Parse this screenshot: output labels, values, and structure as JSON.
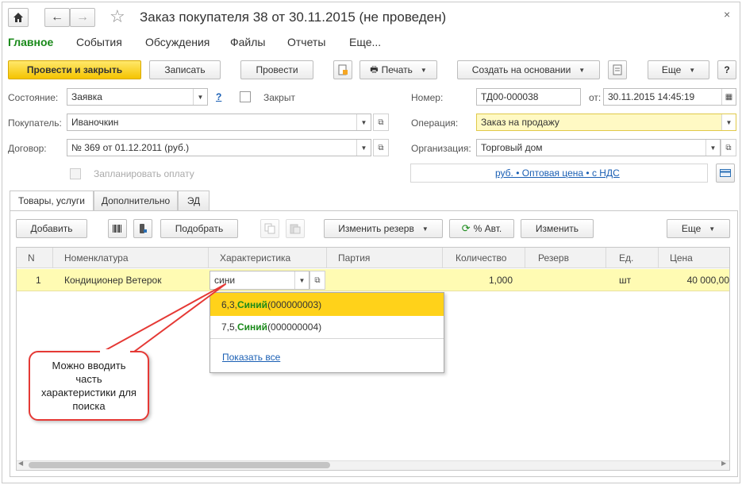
{
  "window": {
    "title": "Заказ покупателя 38 от 30.11.2015 (не проведен)"
  },
  "menu": [
    "Главное",
    "События",
    "Обсуждения",
    "Файлы",
    "Отчеты",
    "Еще..."
  ],
  "toolbar": {
    "post_close": "Провести и закрыть",
    "save": "Записать",
    "post": "Провести",
    "print": "Печать",
    "create_based": "Создать на основании",
    "more": "Еще",
    "help": "?"
  },
  "form": {
    "state_label": "Состояние:",
    "state_value": "Заявка",
    "state_help": "?",
    "closed_label": "Закрыт",
    "number_label": "Номер:",
    "number_value": "ТД00-000038",
    "date_label": "от:",
    "date_value": "30.11.2015 14:45:19",
    "buyer_label": "Покупатель:",
    "buyer_value": "Иваночкин",
    "operation_label": "Операция:",
    "operation_value": "Заказ на продажу",
    "contract_label": "Договор:",
    "contract_value": "№ 369 от 01.12.2011 (руб.)",
    "org_label": "Организация:",
    "org_value": "Торговый дом",
    "plan_payment_label": "Запланировать оплату",
    "price_link": "руб. • Оптовая цена • с НДС"
  },
  "tabs": [
    "Товары, услуги",
    "Дополнительно",
    "ЭД"
  ],
  "table_toolbar": {
    "add": "Добавить",
    "pick": "Подобрать",
    "change_reserve": "Изменить резерв",
    "auto_percent": "% Авт.",
    "change": "Изменить",
    "more": "Еще"
  },
  "table": {
    "columns": [
      "N",
      "Номенклатура",
      "Характеристика",
      "Партия",
      "Количество",
      "Резерв",
      "Ед.",
      "Цена"
    ],
    "rows": [
      {
        "n": "1",
        "item": "Кондиционер Ветерок",
        "characteristic": "сини",
        "batch": "",
        "qty": "1,000",
        "reserve": "",
        "unit": "шт",
        "price": "40 000,00"
      }
    ]
  },
  "dropdown": {
    "options": [
      {
        "prefix": "6,3, ",
        "match": "Синий",
        "suffix": " (000000003)"
      },
      {
        "prefix": "7,5, ",
        "match": "Синий",
        "suffix": " (000000004)"
      }
    ],
    "show_all": "Показать все"
  },
  "callout": {
    "text": "Можно вводить часть характеристики для поиска"
  },
  "colors": {
    "accent_green": "#1a8a1a",
    "primary_yellow": "#f5c400",
    "highlight_row": "#fffbb3",
    "selected_option": "#ffd21a",
    "callout_border": "#e53935"
  }
}
